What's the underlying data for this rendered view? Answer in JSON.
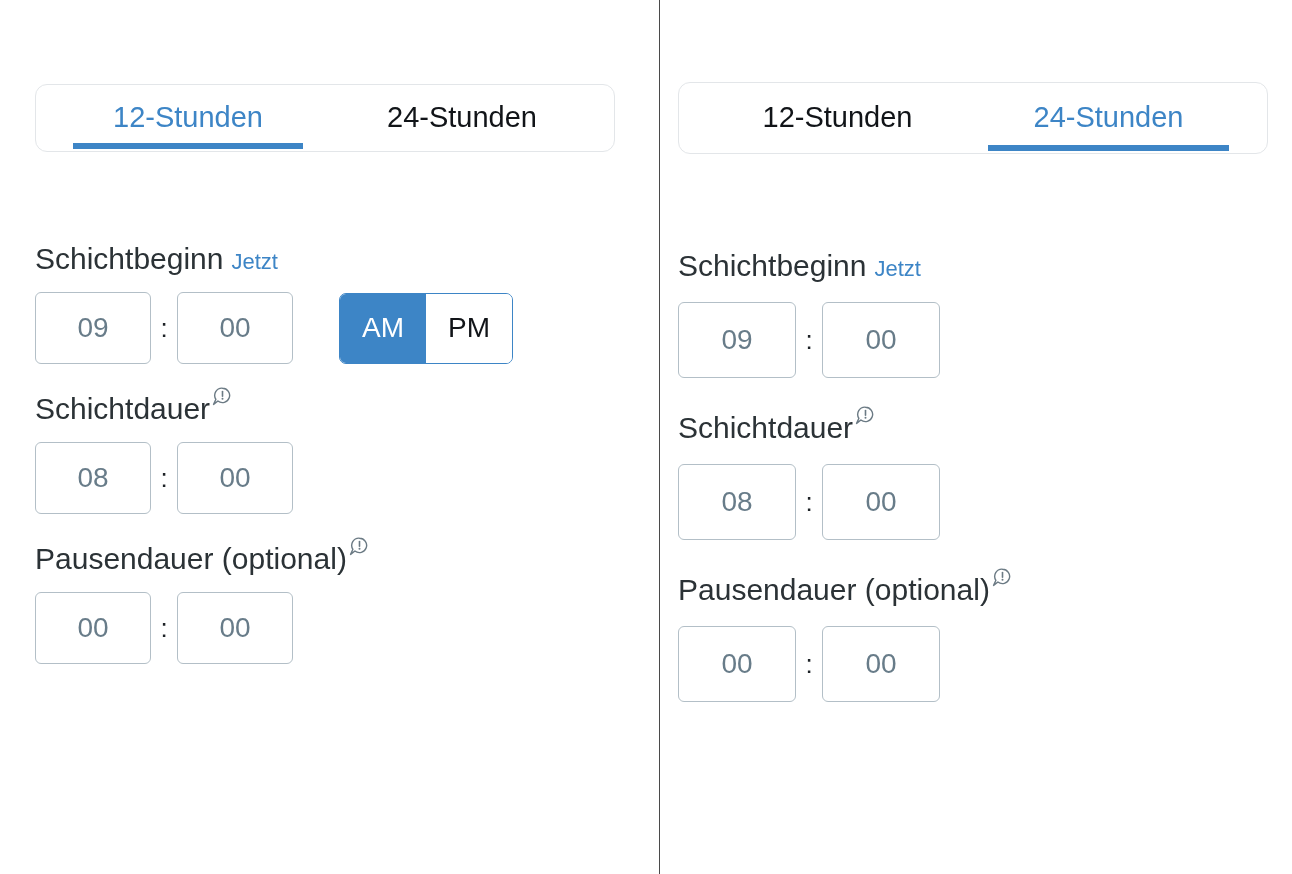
{
  "panels": [
    {
      "tabs": [
        {
          "label": "12-Stunden",
          "selected": true
        },
        {
          "label": "24-Stunden",
          "selected": false
        }
      ],
      "fields": [
        {
          "label": "Schichtbeginn",
          "link": "Jetzt",
          "info": false,
          "hours": "09",
          "separator": ":",
          "minutes": "00",
          "meridiem": [
            {
              "label": "AM",
              "selected": true
            },
            {
              "label": "PM",
              "selected": false
            }
          ]
        },
        {
          "label": "Schichtdauer",
          "info": true,
          "hours": "08",
          "separator": ":",
          "minutes": "00"
        },
        {
          "label": "Pausendauer (optional)",
          "info": true,
          "hours": "00",
          "separator": ":",
          "minutes": "00"
        }
      ]
    },
    {
      "tabs": [
        {
          "label": "12-Stunden",
          "selected": false
        },
        {
          "label": "24-Stunden",
          "selected": true
        }
      ],
      "fields": [
        {
          "label": "Schichtbeginn",
          "link": "Jetzt",
          "info": false,
          "hours": "09",
          "separator": ":",
          "minutes": "00"
        },
        {
          "label": "Schichtdauer",
          "info": true,
          "hours": "08",
          "separator": ":",
          "minutes": "00"
        },
        {
          "label": "Pausendauer (optional)",
          "info": true,
          "hours": "00",
          "separator": ":",
          "minutes": "00"
        }
      ]
    }
  ]
}
